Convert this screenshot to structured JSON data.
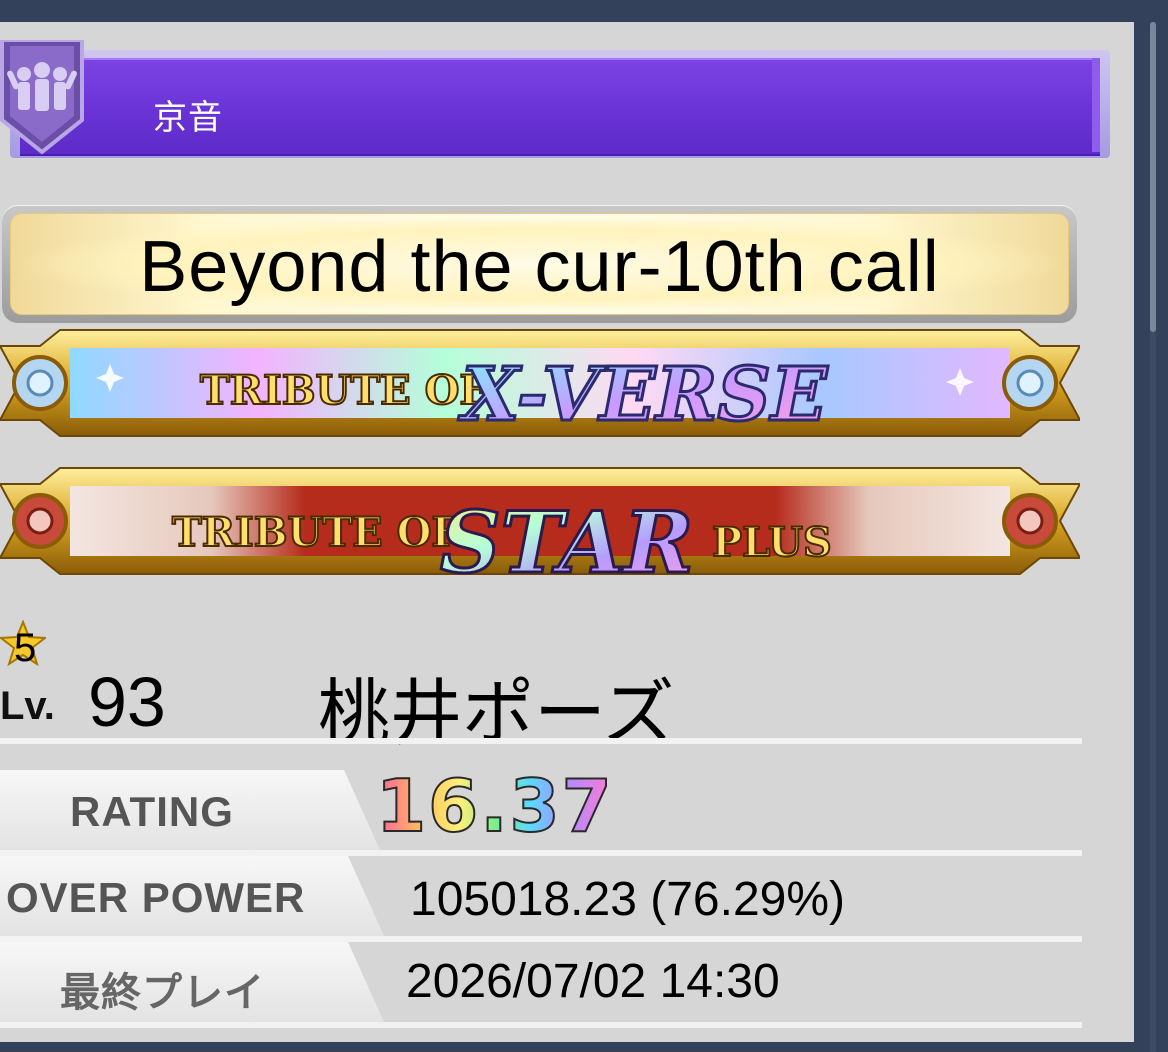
{
  "team": {
    "name": "京音",
    "emblem_icon": "team-emblem-icon"
  },
  "honor": {
    "title": "Beyond the cur-10th call"
  },
  "tributes": [
    {
      "prefix": "TRIBUTE OF",
      "main": "X-VERSE",
      "suffix": ""
    },
    {
      "prefix": "TRIBUTE OF",
      "main": "STAR",
      "suffix": "PLUS"
    }
  ],
  "player": {
    "rank": "5",
    "level_label": "Lv.",
    "level": "93",
    "name": "桃井ポーズ"
  },
  "stats": {
    "rating_label": "RATING",
    "rating": "16.37",
    "over_power_label": "OVER POWER",
    "over_power": "105018.23 (76.29%)",
    "last_play_label": "最終プレイ",
    "last_play": "2026/07/02 14:30"
  },
  "colors": {
    "team_bar": "#6a33d6",
    "page_bg": "#d6d6d6",
    "frame": "#33425a"
  }
}
